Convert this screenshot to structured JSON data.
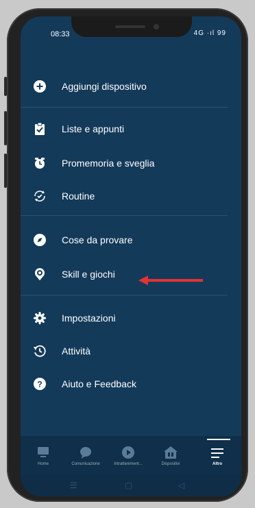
{
  "status": {
    "time": "08:33",
    "right": "4G ·ıl 99"
  },
  "menu": {
    "items": [
      {
        "label": "Aggiungi dispositivo",
        "icon": "plus-circle-icon"
      },
      {
        "label": "Liste e appunti",
        "icon": "clipboard-check-icon"
      },
      {
        "label": "Promemoria e sveglia",
        "icon": "alarm-clock-icon"
      },
      {
        "label": "Routine",
        "icon": "routine-check-icon"
      },
      {
        "label": "Cose da provare",
        "icon": "compass-icon"
      },
      {
        "label": "Skill e giochi",
        "icon": "skill-location-icon"
      },
      {
        "label": "Impostazioni",
        "icon": "gear-icon"
      },
      {
        "label": "Attività",
        "icon": "history-icon"
      },
      {
        "label": "Aiuto e Feedback",
        "icon": "help-circle-icon"
      }
    ]
  },
  "tabbar": {
    "tabs": [
      {
        "label": "Home",
        "icon": "home-icon"
      },
      {
        "label": "Comunicazione",
        "icon": "chat-bubble-icon"
      },
      {
        "label": "Intratteniment...",
        "icon": "play-icon"
      },
      {
        "label": "Dispositivi",
        "icon": "devices-house-icon"
      },
      {
        "label": "Altro",
        "icon": "hamburger-menu-icon",
        "active": true
      }
    ]
  },
  "colors": {
    "background": "#143a5a",
    "arrow": "#e23434"
  }
}
